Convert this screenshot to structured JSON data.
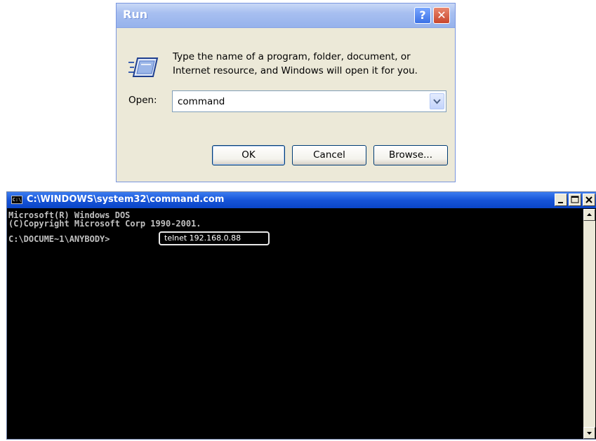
{
  "run_dialog": {
    "title": "Run",
    "help_button": "?",
    "close_button": "✕",
    "description": "Type the name of a program, folder, document, or Internet resource, and Windows will open it for you.",
    "open_label": "Open:",
    "open_value": "command",
    "buttons": {
      "ok": "OK",
      "cancel": "Cancel",
      "browse": "Browse..."
    }
  },
  "command_window": {
    "title": "C:\\WINDOWS\\system32\\command.com",
    "icon_text": "C:\\",
    "lines": [
      "Microsoft(R) Windows DOS",
      "(C)Copyright Microsoft Corp 1990-2001."
    ],
    "prompt": "C:\\DOCUME~1\\ANYBODY>",
    "typed_command": "telnet 192.168.0.88"
  },
  "icons": {
    "run_icon": "run-program-icon",
    "combo_arrow": "chevron-down-icon",
    "console_icon": "console-icon"
  },
  "colors": {
    "dialog_bg": "#ece9d8",
    "title_blue": "#1654d8",
    "close_red": "#c8452d",
    "console_text": "#c0c0c0",
    "console_bg": "#000000"
  }
}
